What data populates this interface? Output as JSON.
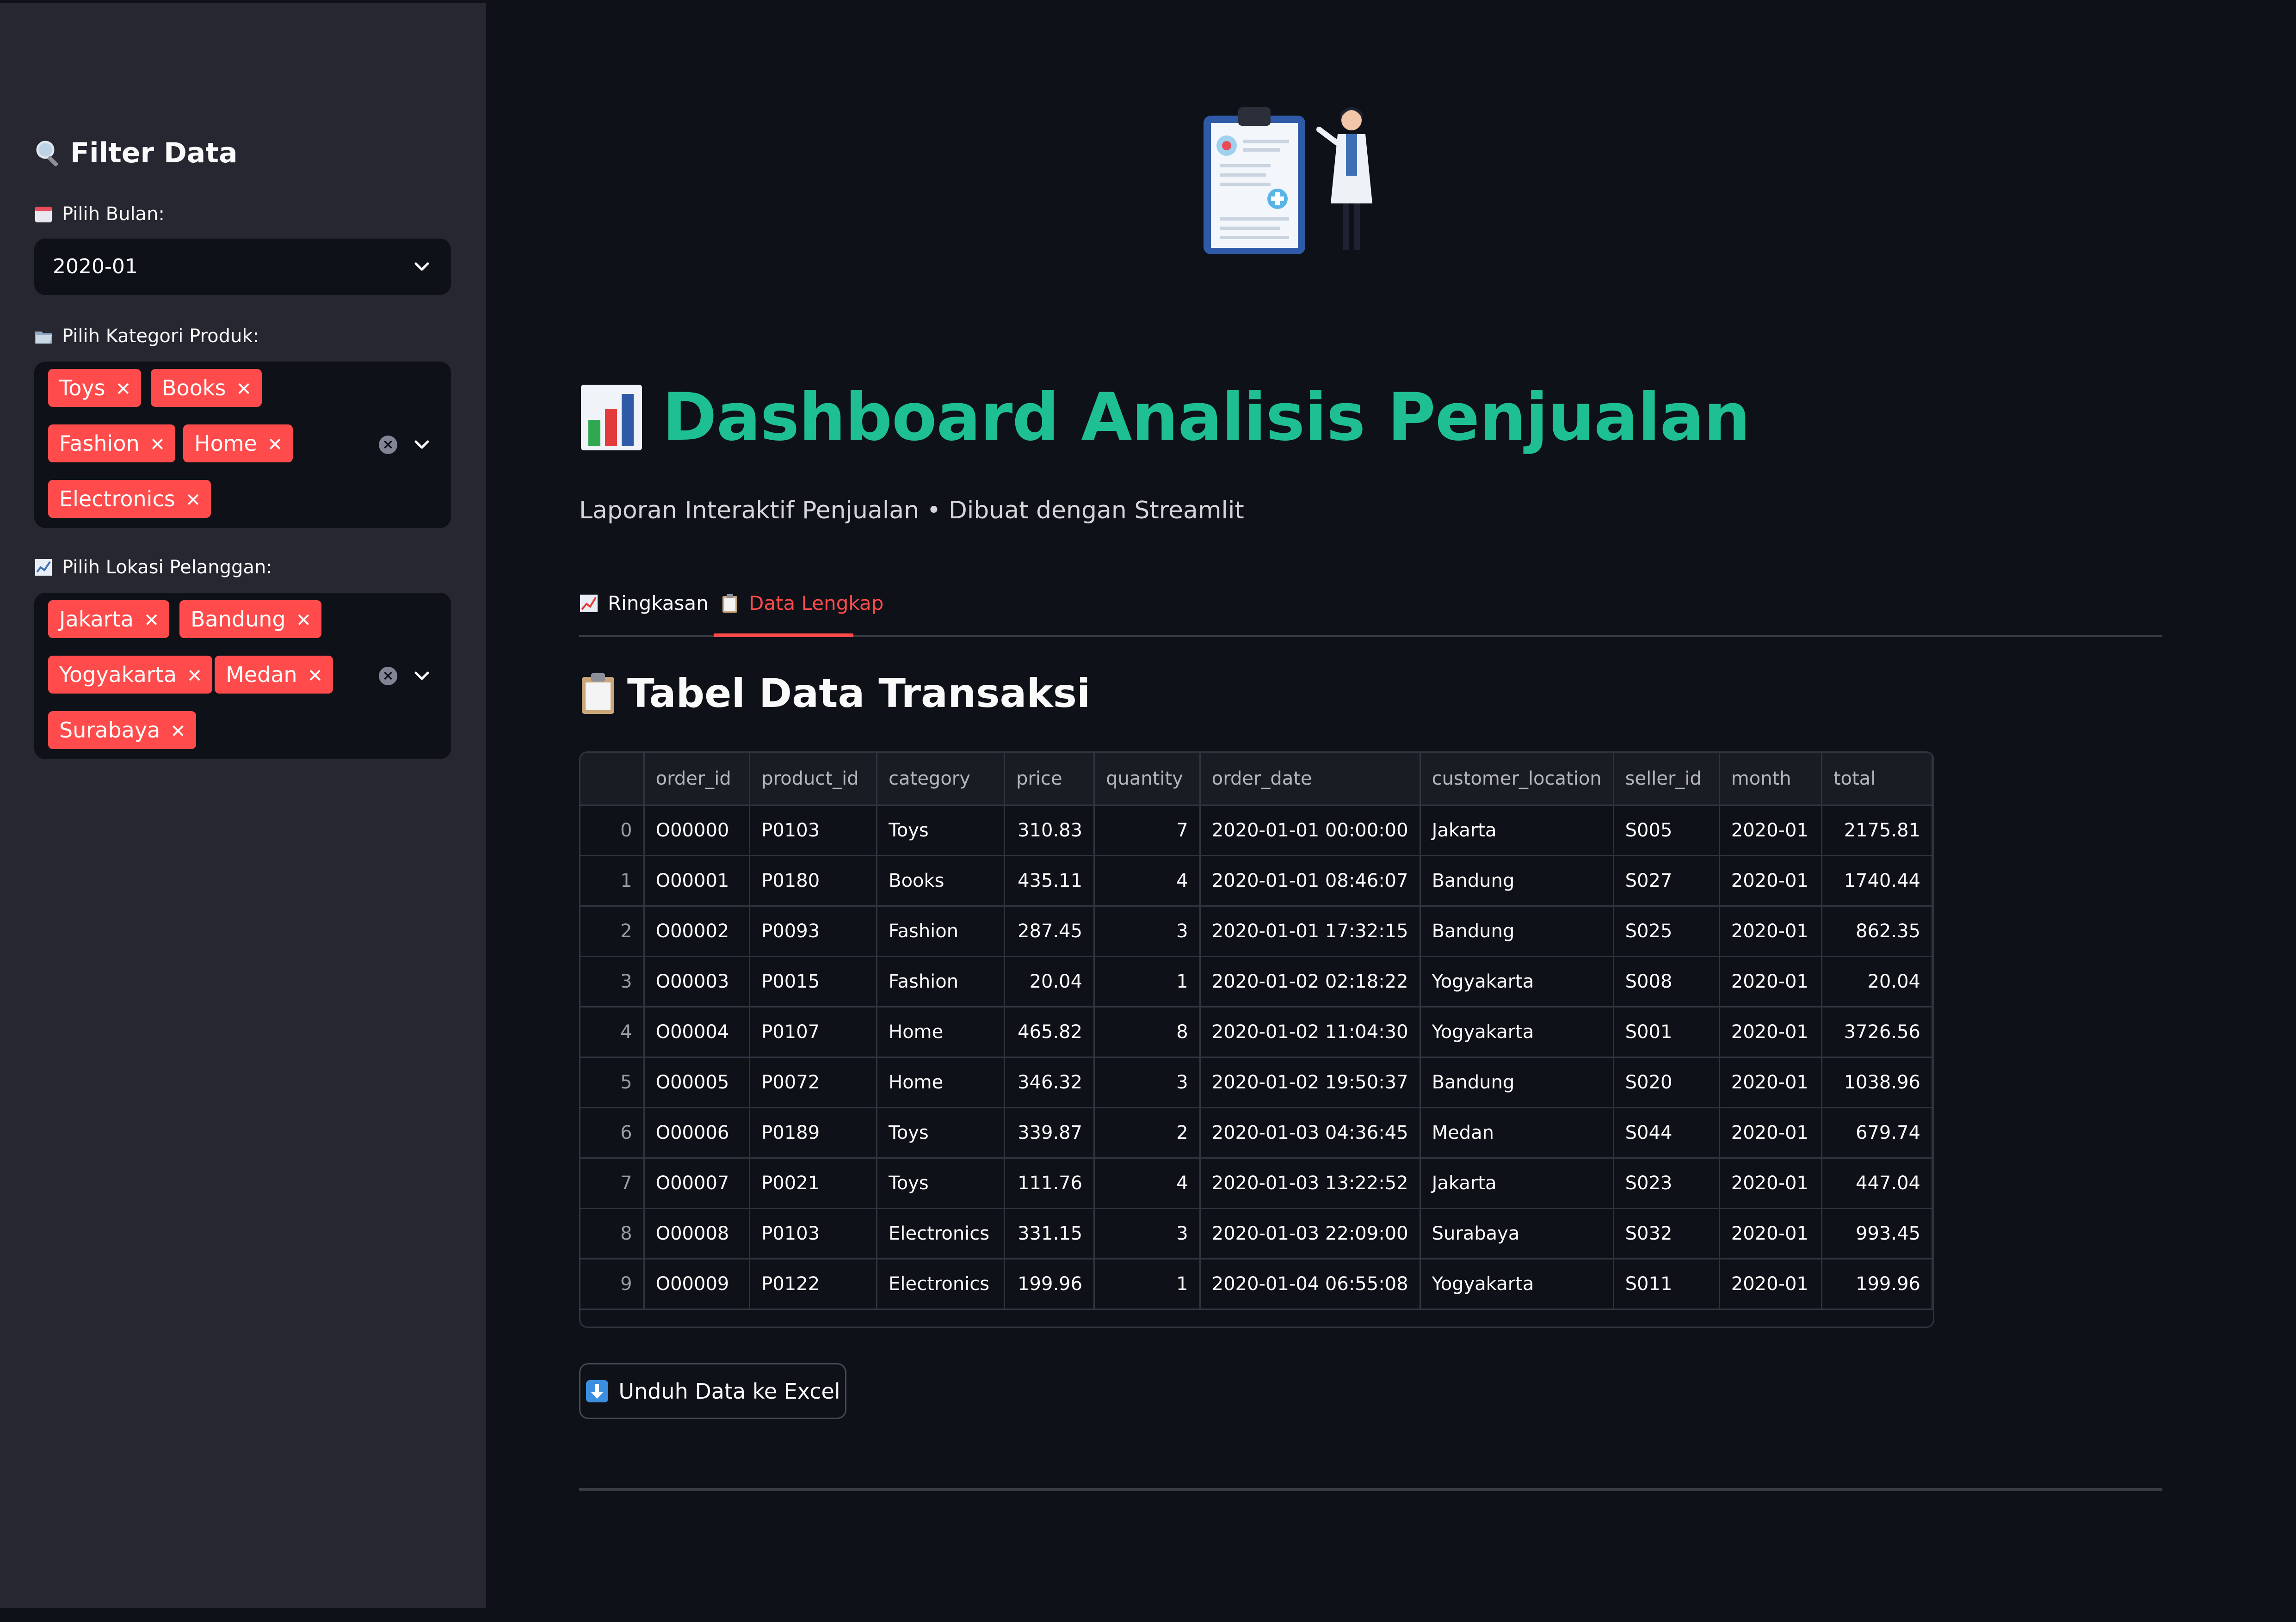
{
  "sidebar": {
    "title": "Filter Data",
    "month_label": "Pilih Bulan:",
    "month_value": "2020-01",
    "category_label": "Pilih Kategori Produk:",
    "categories": [
      "Toys",
      "Books",
      "Fashion",
      "Home",
      "Electronics"
    ],
    "location_label": "Pilih Lokasi Pelanggan:",
    "locations": [
      "Jakarta",
      "Bandung",
      "Yogyakarta",
      "Medan",
      "Surabaya"
    ]
  },
  "header": {
    "title": "Dashboard Analisis Penjualan",
    "subtitle": "Laporan Interaktif Penjualan • Dibuat dengan Streamlit"
  },
  "tabs": [
    {
      "label": "Ringkasan",
      "active": false
    },
    {
      "label": "Data Lengkap",
      "active": true
    }
  ],
  "section": {
    "title": "Tabel Data Transaksi"
  },
  "table": {
    "columns": [
      "",
      "order_id",
      "product_id",
      "category",
      "price",
      "quantity",
      "order_date",
      "customer_location",
      "seller_id",
      "month",
      "total"
    ],
    "rows": [
      [
        "0",
        "O00000",
        "P0103",
        "Toys",
        "310.83",
        "7",
        "2020-01-01 00:00:00",
        "Jakarta",
        "S005",
        "2020-01",
        "2175.81"
      ],
      [
        "1",
        "O00001",
        "P0180",
        "Books",
        "435.11",
        "4",
        "2020-01-01 08:46:07",
        "Bandung",
        "S027",
        "2020-01",
        "1740.44"
      ],
      [
        "2",
        "O00002",
        "P0093",
        "Fashion",
        "287.45",
        "3",
        "2020-01-01 17:32:15",
        "Bandung",
        "S025",
        "2020-01",
        "862.35"
      ],
      [
        "3",
        "O00003",
        "P0015",
        "Fashion",
        "20.04",
        "1",
        "2020-01-02 02:18:22",
        "Yogyakarta",
        "S008",
        "2020-01",
        "20.04"
      ],
      [
        "4",
        "O00004",
        "P0107",
        "Home",
        "465.82",
        "8",
        "2020-01-02 11:04:30",
        "Yogyakarta",
        "S001",
        "2020-01",
        "3726.56"
      ],
      [
        "5",
        "O00005",
        "P0072",
        "Home",
        "346.32",
        "3",
        "2020-01-02 19:50:37",
        "Bandung",
        "S020",
        "2020-01",
        "1038.96"
      ],
      [
        "6",
        "O00006",
        "P0189",
        "Toys",
        "339.87",
        "2",
        "2020-01-03 04:36:45",
        "Medan",
        "S044",
        "2020-01",
        "679.74"
      ],
      [
        "7",
        "O00007",
        "P0021",
        "Toys",
        "111.76",
        "4",
        "2020-01-03 13:22:52",
        "Jakarta",
        "S023",
        "2020-01",
        "447.04"
      ],
      [
        "8",
        "O00008",
        "P0103",
        "Electronics",
        "331.15",
        "3",
        "2020-01-03 22:09:00",
        "Surabaya",
        "S032",
        "2020-01",
        "993.45"
      ],
      [
        "9",
        "O00009",
        "P0122",
        "Electronics",
        "199.96",
        "1",
        "2020-01-04 06:55:08",
        "Yogyakarta",
        "S011",
        "2020-01",
        "199.96"
      ]
    ]
  },
  "download_button": {
    "label": "Unduh Data ke Excel"
  },
  "colors": {
    "accent": "#ff4b4b",
    "title": "#1fbf94",
    "background": "#0e1117",
    "sidebar": "#262730"
  },
  "icons": {
    "sidebar_title": "magnifier-icon",
    "month": "calendar-icon",
    "category": "folder-icon",
    "location": "chart-icon",
    "page_title": "bar-chart-icon",
    "tab_summary": "chart-up-icon",
    "tab_data": "clipboard-icon",
    "section": "clipboard-icon",
    "download": "download-arrow-icon"
  }
}
